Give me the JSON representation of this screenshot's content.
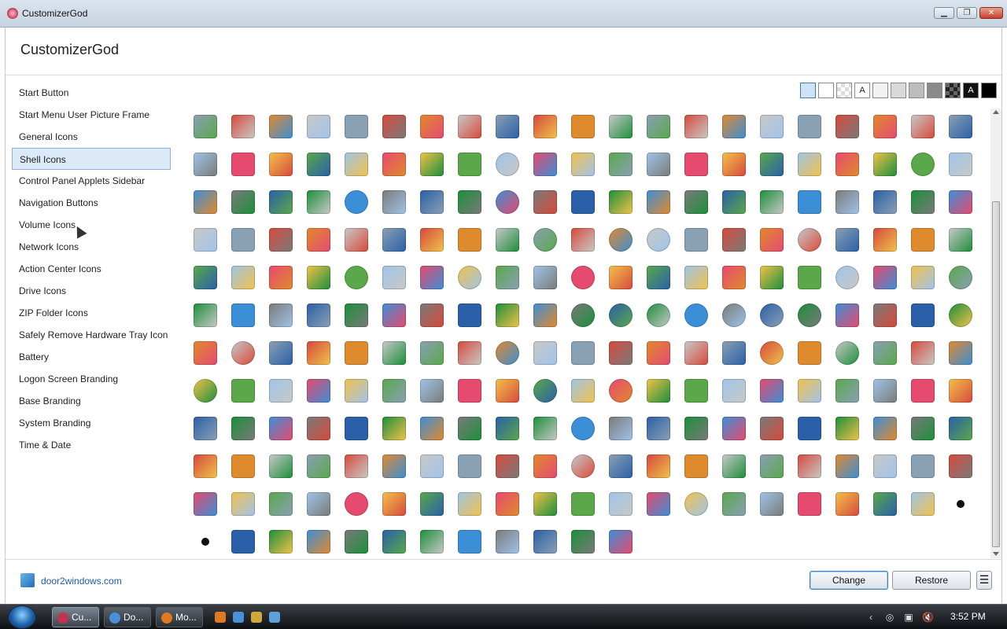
{
  "window": {
    "title": "CustomizerGod",
    "controls": {
      "minimize": "▁",
      "maximize": "❐",
      "close": "✕"
    }
  },
  "header": {
    "app_name": "CustomizerGod"
  },
  "sidebar": {
    "selected": "Shell Icons",
    "items": [
      {
        "label": "Start Button"
      },
      {
        "label": "Start Menu User Picture Frame"
      },
      {
        "label": "General Icons"
      },
      {
        "label": "Shell Icons"
      },
      {
        "label": "Control Panel Applets Sidebar"
      },
      {
        "label": "Navigation Buttons"
      },
      {
        "label": "Volume Icons"
      },
      {
        "label": "Network Icons"
      },
      {
        "label": "Action Center Icons"
      },
      {
        "label": "Drive Icons"
      },
      {
        "label": "ZIP Folder Icons"
      },
      {
        "label": "Safely Remove Hardware Tray Icon"
      },
      {
        "label": "Battery"
      },
      {
        "label": "Logon Screen Branding"
      },
      {
        "label": "Base Branding"
      },
      {
        "label": "System Branding"
      },
      {
        "label": "Time & Date"
      }
    ]
  },
  "backgrounds": {
    "swatches": [
      {
        "name": "blue-selected",
        "color": "#cfe3f7",
        "label": ""
      },
      {
        "name": "white",
        "color": "#ffffff",
        "label": ""
      },
      {
        "name": "checker",
        "color": "#eeeeee",
        "label": ""
      },
      {
        "name": "text-light",
        "color": "#ffffff",
        "label": "A"
      },
      {
        "name": "lightgray-1",
        "color": "#f2f2f2",
        "label": ""
      },
      {
        "name": "lightgray-2",
        "color": "#d9d9d9",
        "label": ""
      },
      {
        "name": "gray-1",
        "color": "#bdbdbd",
        "label": ""
      },
      {
        "name": "gray-2",
        "color": "#8a8a8a",
        "label": ""
      },
      {
        "name": "dark-checker",
        "color": "#3a3a3a",
        "label": ""
      },
      {
        "name": "text-dark",
        "color": "#111111",
        "label": "A"
      },
      {
        "name": "black",
        "color": "#000000",
        "label": ""
      }
    ]
  },
  "icon_grid": {
    "rows": [
      [
        "recycle-bin-empty",
        "recycle-bin-full",
        "warning-document",
        "warning-folder",
        "folder-pinned",
        "document-arrow",
        "gear-document",
        "blank-document",
        "gear-window",
        "gear-doc-small",
        "font-a",
        "font-tt",
        "font-script",
        "window-shortcut",
        "warning-triangle",
        "network-printer",
        "drive-gray",
        "rainbow-boxes",
        "printer-check",
        "fax-printer",
        "printer-disk"
      ],
      [
        "diagram-doc",
        "folder-share",
        "star-folder",
        "folder-list",
        "network-computers",
        "image-folder",
        "calendar-grid",
        "image-frame",
        "globe-computer",
        "monitor-window",
        "monitor-blue",
        "details-view",
        "tiles-view",
        "list-view",
        "windows-stack",
        "hand-pointer",
        "cursor-doc",
        "recycle-green",
        "recycle-full-green",
        "globe-folder",
        "keys"
      ],
      [
        "scanner",
        "printer-check-2",
        "network-printer-2",
        "printer-plain",
        "blocked-circle",
        "folder-doc",
        "user-keys",
        "power-button",
        "dvd-disc",
        "documents-stack",
        "film-strip",
        "music-note",
        "camera",
        "mobile-photo",
        "music-cd",
        "mouse",
        "card-reader",
        "download-arrow",
        "small-download",
        "drive-flat",
        "keyboard-x"
      ],
      [
        "folder-open",
        "folder-person",
        "music-folder",
        "folder-media",
        "butterfly",
        "red-x",
        "document-arrow-2",
        "network-adapter",
        "documents",
        "globe-arrow",
        "printer-glossy",
        "play-circle",
        "globe-blue",
        "camera-2",
        "projector",
        "network-tool",
        "globe-window",
        "printer-cable",
        "check-mark",
        "recycle-empty-2",
        "green-arrow"
      ],
      [
        "warning-folders",
        "network-tray",
        "add-computer",
        "home-network",
        "pink-disc",
        "document-x",
        "cd-tool",
        "help-circle",
        "folder-plain",
        "envelope-card",
        "pink-disc-2",
        "users-folder",
        "blue-grid",
        "users-pair",
        "computer-window",
        "phone-book",
        "scanner-2",
        "network-globe",
        "checklist",
        "pie-chart",
        "globe-clock"
      ],
      [
        "speaker-box",
        "sound-box",
        "users-group",
        "search-window",
        "network-signal",
        "keyboard-blue",
        "monitor-black",
        "help-doc",
        "green-arrow-box",
        "dvd-drive",
        "globe-plus",
        "help-disc",
        "cd-rom-disc",
        "cd-r-disc",
        "cd-rw-disc",
        "dvd-ram-disc",
        "dvd-r-disc",
        "tower-pc",
        "drive-dark",
        "drive-silver",
        "disc-silver"
      ],
      [
        "calendar-orange",
        "dvd-rom-disc",
        "drive-slim",
        "mobile-dark",
        "memory-card",
        "media-card",
        "camera-3",
        "mobile-phone",
        "globe-printer",
        "green-device",
        "blue-stick",
        "pda-device",
        "usb-drive",
        "camera-black",
        "webcam",
        "dvd-rw-disc",
        "note-star",
        "pink-disc-3",
        "chart-window",
        "star-gold",
        "magnifier"
      ],
      [
        "help-circle-2",
        "key-yellow",
        "calendar-folder",
        "network-drive",
        "blue-window",
        "red-power",
        "checkbox-doc",
        "eject-box",
        "search-doc",
        "blocked-circle-2",
        "ie-logo",
        "info-circle",
        "printer-edit",
        "paint-brush",
        "help-doc-2",
        "fax-machine",
        "printer-white",
        "printer-doc",
        "printer-green",
        "printer-green-2",
        "printer-users"
      ],
      [
        "scanner-3",
        "computer-server",
        "warning-triangle-2",
        "document-x-2",
        "warning-triangle-3",
        "warning-triangle-4",
        "warning-triangle-5",
        "blue-arrows",
        "clock-arrow",
        "split-window",
        "network-globe-2",
        "ie-logo-2",
        "usb-plug",
        "shield-warning",
        "toolbar-grid",
        "chevron-up",
        "chevron-down",
        "filter-lines",
        "network-arrow",
        "copy-stack",
        "window-grid"
      ],
      [
        "panel-left",
        "reading-pane",
        "arrow-left-pale",
        "arrow-right-pale",
        "panel-bottom",
        "layout-window",
        "floppy-disk",
        "scissors",
        "clipboard",
        "media-play",
        "pink-disc-4",
        "shortcut-arrow",
        "users-card",
        "clock-dark",
        "folder-zip",
        "double-chevron",
        "magnifier-2",
        "edit-doc",
        "printer-search",
        "document-x-3",
        "network-monitor"
      ],
      [
        "drive-check",
        "computer-x",
        "folder-check",
        "network-blue",
        "info-circle-2",
        "add-folder",
        "add-folder-2",
        "media-folder",
        "user-outline",
        "window-list",
        "grid-outline",
        "doc-outline",
        "book-outline",
        "disc-outline",
        "star-outline",
        "squares-outline",
        "tag-outline",
        "page-outline",
        "cd-outline",
        "users-outline",
        "black-dot"
      ],
      [
        "black-dot-2",
        "blank-window",
        "add-folder-3",
        "files-tree",
        "list-lines",
        "details-lines",
        "list-columns",
        "landscape-photo",
        "landscape-photo-2",
        "thumbs-grid",
        "thumbs-grid-2",
        "list-lines-2"
      ]
    ],
    "colors": [
      "#8aa0b3",
      "#f0c24b",
      "#3c8ed6",
      "#d64a3c",
      "#5aa84a",
      "#7a7a7a",
      "#e08a2e",
      "#a0c4e8",
      "#2b5fa8",
      "#c8c8c8",
      "#e64a6e",
      "#1b8f3a"
    ]
  },
  "footer": {
    "link": "door2windows.com",
    "change_label": "Change",
    "restore_label": "Restore",
    "menu_label": "☰"
  },
  "taskbar": {
    "tasks": [
      {
        "label": "Cu...",
        "color": "#c2344e",
        "active": true
      },
      {
        "label": "Do...",
        "color": "#4a90d9",
        "active": false
      },
      {
        "label": "Mo...",
        "color": "#e07a22",
        "active": false
      }
    ],
    "quicklaunch": [
      "#e07a22",
      "#4a90d9",
      "#cfa93c",
      "#5fa0d8"
    ],
    "tray": [
      "‹",
      "◎",
      "▣",
      "🔇"
    ],
    "clock": "3:52 PM"
  }
}
